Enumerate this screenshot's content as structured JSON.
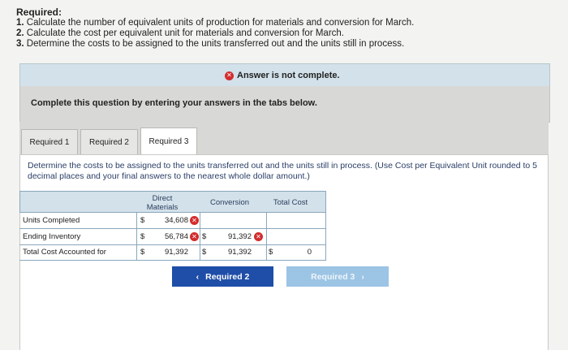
{
  "requirements": {
    "heading": "Required:",
    "items": [
      {
        "num": "1.",
        "text": "Calculate the number of equivalent units of production for materials and conversion for March."
      },
      {
        "num": "2.",
        "text": "Calculate the cost per equivalent unit for materials and conversion for March."
      },
      {
        "num": "3.",
        "text": "Determine the costs to be assigned to the units transferred out and the units still in process."
      }
    ]
  },
  "banner": {
    "message": "Answer is not complete.",
    "icon": "x-circle-icon",
    "icon_color": "#d32c2c"
  },
  "question_bar": {
    "text": "Complete this question by entering your answers in the tabs below."
  },
  "tabs": [
    {
      "label": "Required 1",
      "active": false
    },
    {
      "label": "Required 2",
      "active": false
    },
    {
      "label": "Required 3",
      "active": true
    }
  ],
  "instructions": "Determine the costs to be assigned to the units transferred out and the units still in process. (Use Cost per Equivalent Unit rounded to 5 decimal places and your final answers to the nearest whole dollar amount.)",
  "table": {
    "headers": {
      "materials_line1": "Direct",
      "materials_line2": "Materials",
      "conversion": "Conversion",
      "total": "Total Cost"
    },
    "rows": [
      {
        "label": "Units Completed",
        "materials_dollar": "$",
        "materials": "34,608",
        "materials_incorrect": true,
        "conversion_dollar": "",
        "conversion": "",
        "conversion_incorrect": false,
        "total_dollar": "",
        "total": ""
      },
      {
        "label": "Ending Inventory",
        "materials_dollar": "$",
        "materials": "56,784",
        "materials_incorrect": true,
        "conversion_dollar": "$",
        "conversion": "91,392",
        "conversion_incorrect": true,
        "total_dollar": "",
        "total": ""
      },
      {
        "label": "Total Cost Accounted for",
        "materials_dollar": "$",
        "materials": "91,392",
        "materials_incorrect": false,
        "conversion_dollar": "$",
        "conversion": "91,392",
        "conversion_incorrect": false,
        "total_dollar": "$",
        "total": "0"
      }
    ]
  },
  "navigation": {
    "prev_label": "Required 2",
    "next_label": "Required 3",
    "prev_icon": "chevron-left-icon",
    "next_icon": "chevron-right-icon",
    "prev_color": "#1e4ea8",
    "next_color": "#9cc4e4"
  }
}
